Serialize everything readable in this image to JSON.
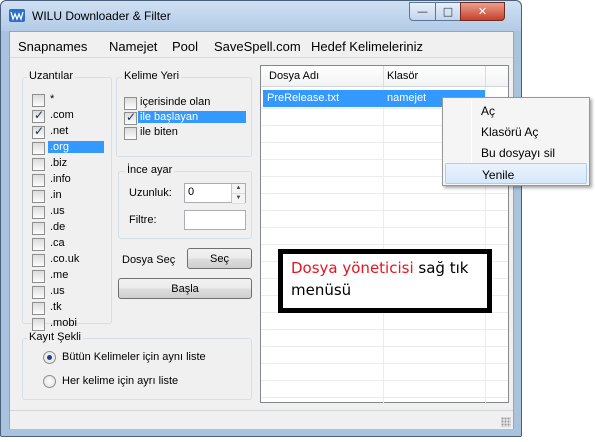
{
  "window": {
    "title": "WILU Downloader & Filter",
    "controls": {
      "minimize": "—",
      "maximize": "□",
      "close": "✕"
    }
  },
  "menu": [
    "Snapnames",
    "Namejet",
    "Pool",
    "SaveSpell.com",
    "Hedef Kelimeleriniz"
  ],
  "extensions": {
    "label": "Uzantılar",
    "items": [
      {
        "label": "*",
        "checked": false,
        "selected": false
      },
      {
        "label": ".com",
        "checked": true,
        "selected": false
      },
      {
        "label": ".net",
        "checked": true,
        "selected": false
      },
      {
        "label": ".org",
        "checked": false,
        "selected": true
      },
      {
        "label": ".biz",
        "checked": false,
        "selected": false
      },
      {
        "label": ".info",
        "checked": false,
        "selected": false
      },
      {
        "label": ".in",
        "checked": false,
        "selected": false
      },
      {
        "label": ".us",
        "checked": false,
        "selected": false
      },
      {
        "label": ".de",
        "checked": false,
        "selected": false
      },
      {
        "label": ".ca",
        "checked": false,
        "selected": false
      },
      {
        "label": ".co.uk",
        "checked": false,
        "selected": false
      },
      {
        "label": ".me",
        "checked": false,
        "selected": false
      },
      {
        "label": ".us",
        "checked": false,
        "selected": false
      },
      {
        "label": ".tk",
        "checked": false,
        "selected": false
      },
      {
        "label": ".mobi",
        "checked": false,
        "selected": false
      }
    ]
  },
  "word_position": {
    "label": "Kelime Yeri",
    "items": [
      {
        "label": "içerisinde olan",
        "checked": false,
        "selected": false
      },
      {
        "label": "ile başlayan",
        "checked": true,
        "selected": true
      },
      {
        "label": "ile biten",
        "checked": false,
        "selected": false
      }
    ]
  },
  "fine_tune": {
    "label": "İnce ayar",
    "length_label": "Uzunluk:",
    "length_value": "0",
    "filter_label": "Filtre:",
    "filter_value": ""
  },
  "file_select": {
    "label": "Dosya Seç",
    "button": "Seç"
  },
  "start_button": "Başla",
  "save_mode": {
    "label": "Kayıt Şekli",
    "options": [
      {
        "label": "Bütün Kelimeler için aynı liste",
        "checked": true
      },
      {
        "label": "Her kelime için ayrı liste",
        "checked": false
      }
    ]
  },
  "file_list": {
    "columns": [
      "Dosya Adı",
      "Klasör"
    ],
    "rows": [
      {
        "name": "PreRelease.txt",
        "folder": "namejet",
        "selected": true
      }
    ]
  },
  "context_menu": {
    "items": [
      {
        "label": "Aç",
        "highlighted": false
      },
      {
        "label": "Klasörü Aç",
        "highlighted": false
      },
      {
        "label": "Bu dosyayı sil",
        "highlighted": false
      },
      {
        "label": "Yenile",
        "highlighted": true
      }
    ]
  },
  "callout": {
    "highlight": "Dosya yöneticisi",
    "rest": " sağ tık menüsü",
    "highlight_color": "#e8131f"
  },
  "colors": {
    "selection": "#3399ff",
    "title_bg": "#b9cfe8"
  }
}
